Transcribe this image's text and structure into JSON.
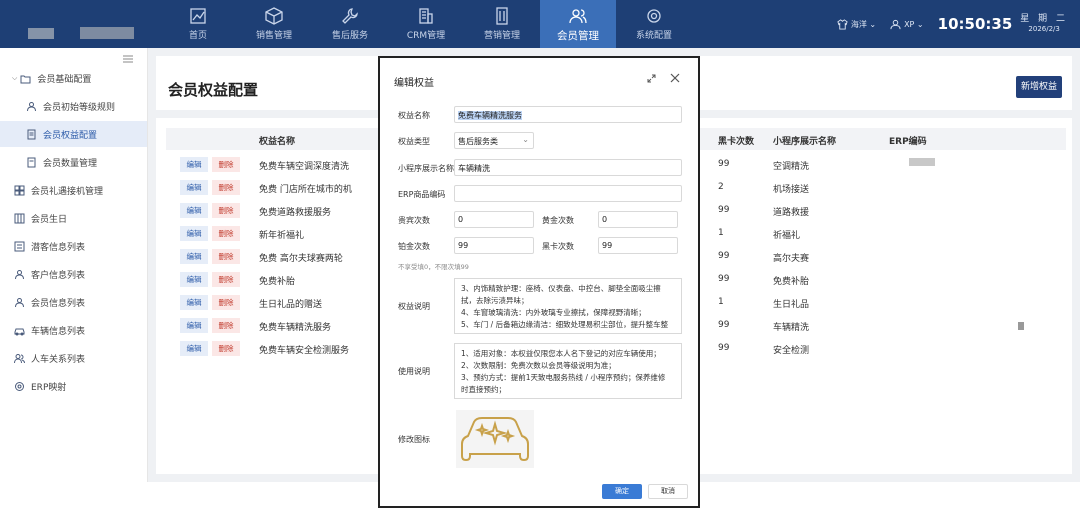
{
  "nav": [
    {
      "label": "首页",
      "icon": "chart-icon"
    },
    {
      "label": "销售管理",
      "icon": "box-icon"
    },
    {
      "label": "售后服务",
      "icon": "wrench-icon"
    },
    {
      "label": "CRM管理",
      "icon": "building-icon"
    },
    {
      "label": "营销管理",
      "icon": "office-icon"
    },
    {
      "label": "会员管理",
      "icon": "users-icon",
      "active": true
    },
    {
      "label": "系统配置",
      "icon": "gears-icon"
    }
  ],
  "header": {
    "user1": "海洋",
    "user2": "XP",
    "time": "10:50:35",
    "weekday": "星 期 二",
    "date": "2026/2/3"
  },
  "sidebar": {
    "items": [
      {
        "label": "会员基础配置",
        "icon": "folder-icon"
      },
      {
        "label": "会员初始等级规则",
        "icon": "person-icon"
      },
      {
        "label": "会员权益配置",
        "icon": "doc-icon",
        "active": true
      },
      {
        "label": "会员数量管理",
        "icon": "doc-icon"
      },
      {
        "label": "会员礼遇接机管理",
        "icon": "grid-icon"
      },
      {
        "label": "会员生日",
        "icon": "table-icon"
      },
      {
        "label": "潜客信息列表",
        "icon": "list-icon"
      },
      {
        "label": "客户信息列表",
        "icon": "person-icon"
      },
      {
        "label": "会员信息列表",
        "icon": "person-icon"
      },
      {
        "label": "车辆信息列表",
        "icon": "car-icon"
      },
      {
        "label": "人车关系列表",
        "icon": "people-icon"
      },
      {
        "label": "ERP映射",
        "icon": "gear-icon"
      }
    ]
  },
  "page": {
    "title": "会员权益配置",
    "add_button": "新增权益"
  },
  "table": {
    "headers": [
      "权益名称",
      "黑卡次数",
      "小程序展示名称",
      "ERP编码"
    ],
    "edit": "编辑",
    "delete": "删除",
    "rows": [
      {
        "name": "免费车辆空调深度清洗",
        "black": "99",
        "mp": "空调精洗"
      },
      {
        "name": "免费    门店所在城市的机",
        "black": "2",
        "mp": "机场接送"
      },
      {
        "name": "免费道路救援服务",
        "black": "99",
        "mp": "道路救援"
      },
      {
        "name": "新年祈福礼",
        "black": "1",
        "mp": "祈福礼"
      },
      {
        "name": "免费         高尔夫球赛两轮",
        "black": "99",
        "mp": "高尔夫赛"
      },
      {
        "name": "免费补胎",
        "black": "99",
        "mp": "免费补胎"
      },
      {
        "name": "生日礼品的赠送",
        "black": "1",
        "mp": "生日礼品"
      },
      {
        "name": "免费车辆精洗服务",
        "black": "99",
        "mp": "车辆精洗"
      },
      {
        "name": "免费车辆安全检测服务",
        "black": "99",
        "mp": "安全检测"
      }
    ]
  },
  "dialog": {
    "title": "编辑权益",
    "name_label": "权益名称",
    "name_value": "免费车辆精洗服务",
    "type_label": "权益类型",
    "type_value": "售后服务类",
    "mp_label": "小程序展示名称",
    "mp_value": "车辆精洗",
    "erp_label": "ERP商品编码",
    "erp_value": "",
    "gui_label": "贵宾次数",
    "gui_value": "0",
    "gold_label": "黄金次数",
    "gold_value": "0",
    "plat_label": "铂金次数",
    "plat_value": "99",
    "black_label": "黑卡次数",
    "black_value": "99",
    "hint": "不享受填0，不限次填99",
    "desc_label": "权益说明",
    "desc_lines": [
      "3、内饰精致护理：座椅、仪表盘、中控台、脚垫全面吸尘擦",
      "拭，去除污渍异味；",
      "4、车窗玻璃清洗：内外玻璃专业擦拭，保障视野清晰；",
      "5、车门 / 后备箱边缘清洁：细致处理易积尘部位，提升整车整"
    ],
    "use_label": "使用说明",
    "use_lines": [
      "1、适用对象：本权益仅限您本人名下登记的对应车辆使用；",
      "2、次数限制：免费次数以会员等级说明为准；",
      "3、预约方式：提前1天致电服务热线 / 小程序预约；保养维修",
      "时直接预约；"
    ],
    "icon_label": "修改图标",
    "ok": "确定",
    "cancel": "取消"
  }
}
